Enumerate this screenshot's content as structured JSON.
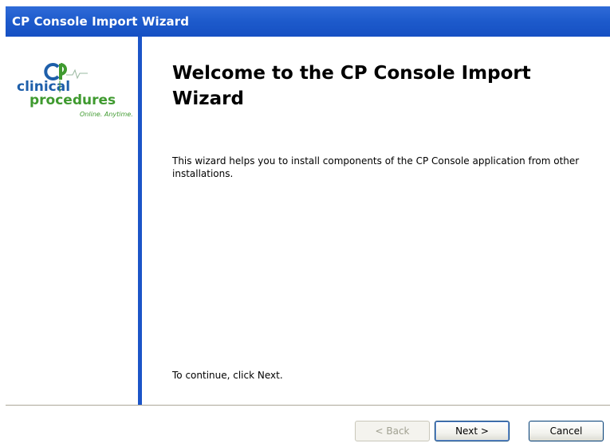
{
  "window": {
    "title": "CP Console Import Wizard"
  },
  "logo": {
    "brand_line1": "clinical",
    "brand_line2": "procedures",
    "tagline": "Online. Anytime."
  },
  "content": {
    "heading": "Welcome to the CP Console Import Wizard",
    "intro": "This wizard helps you to install components of the CP Console application from other installations.",
    "continue_hint": "To continue, click Next."
  },
  "buttons": {
    "back": "< Back",
    "next": "Next >",
    "cancel": "Cancel"
  },
  "colors": {
    "titlebar": "#1d5acb",
    "sidebar_divider": "#1c55c8",
    "logo_green": "#3f9a2f",
    "logo_blue": "#1e5faa"
  }
}
